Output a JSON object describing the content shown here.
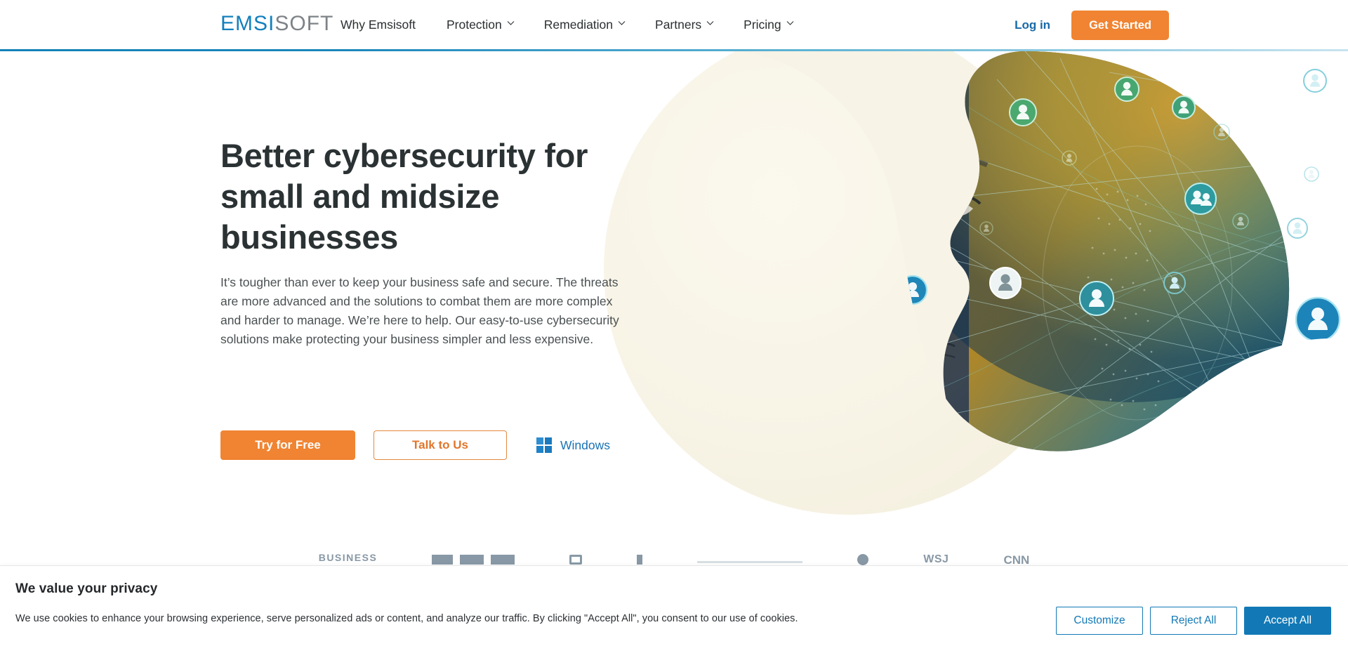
{
  "brand": {
    "logo_primary": "EMSI",
    "logo_secondary": "SOFT",
    "logo_primary_color": "#1380BD",
    "logo_secondary_color": "#7D8387",
    "accent_orange": "#F08432",
    "accent_blue": "#1279B6",
    "rule_color": "#1282b8"
  },
  "header": {
    "nav": [
      {
        "label": "Why Emsisoft",
        "has_caret": false
      },
      {
        "label": "Protection",
        "has_caret": true
      },
      {
        "label": "Remediation",
        "has_caret": true
      },
      {
        "label": "Partners",
        "has_caret": true
      },
      {
        "label": "Pricing",
        "has_caret": true
      }
    ],
    "login_label": "Log in",
    "get_started_label": "Get Started"
  },
  "hero": {
    "title": "Better cybersecurity for small and midsize businesses",
    "subtitle": "It’s tougher than ever to keep your business safe and secure. The threats are more advanced and the solutions to combat them are more complex and harder to manage. We’re here to help. Our easy-to-use cybersecurity solutions make protecting your business simpler and less expensive.",
    "primary_cta": "Try for Free",
    "secondary_cta": "Talk to Us",
    "platform_label": "Windows"
  },
  "partners": {
    "logos": [
      "BUSINESS",
      "",
      "",
      "",
      "",
      "",
      "WSJ",
      "CNN"
    ]
  },
  "cookie": {
    "title": "We value your privacy",
    "text": "We use cookies to enhance your browsing experience, serve personalized ads or content, and analyze our traffic. By clicking \"Accept All\", you consent to our use of cookies.",
    "customize_label": "Customize",
    "reject_label": "Reject All",
    "accept_label": "Accept All"
  }
}
